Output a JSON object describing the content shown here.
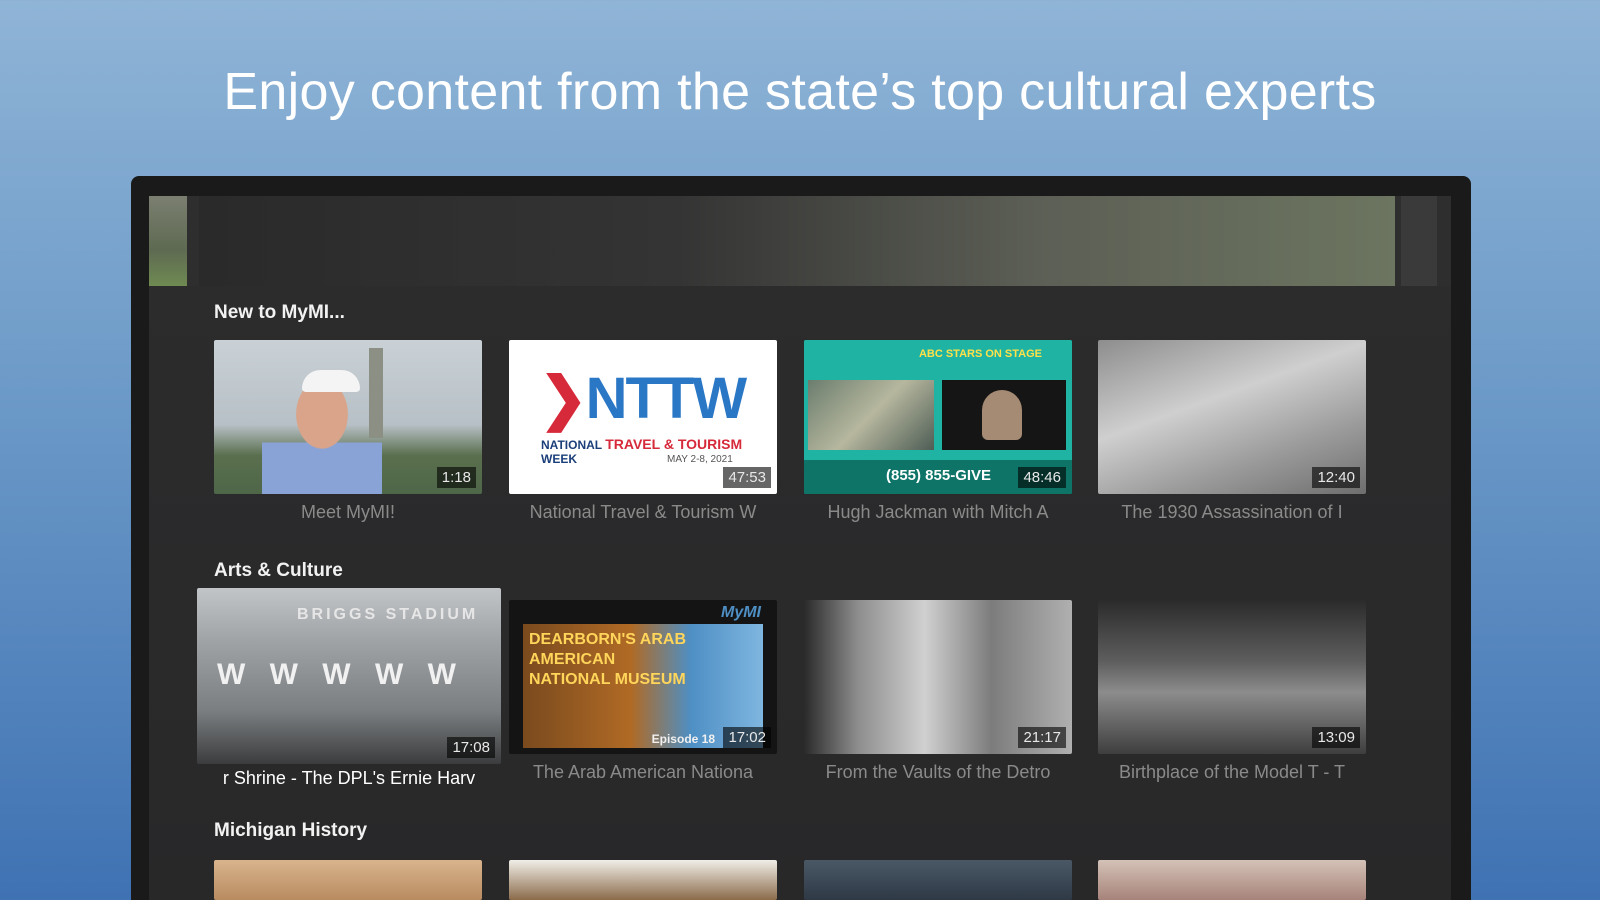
{
  "headline": "Enjoy content from the state’s top cultural experts",
  "rows": [
    {
      "title": "New to MyMI...",
      "items": [
        {
          "caption": "Meet MyMI!",
          "duration": "1:18"
        },
        {
          "caption": "National Travel & Tourism W",
          "duration": "47:53"
        },
        {
          "caption": "Hugh Jackman with Mitch A",
          "duration": "48:46"
        },
        {
          "caption": "The 1930 Assassination of I",
          "duration": "12:40"
        }
      ]
    },
    {
      "title": "Arts & Culture",
      "items": [
        {
          "caption": "r Shrine - The DPL's Ernie Harv",
          "duration": "17:08"
        },
        {
          "caption": "The Arab American Nationa",
          "duration": "17:02"
        },
        {
          "caption": "From the Vaults of the Detro",
          "duration": "21:17"
        },
        {
          "caption": "Birthplace of the Model T - T",
          "duration": "13:09"
        }
      ]
    },
    {
      "title": "Michigan History",
      "items": []
    }
  ],
  "thumbs": {
    "nttw_logo": "NTTW",
    "nttw_sub_national": "NATIONAL",
    "nttw_sub_travel": "TRAVEL & TOURISM",
    "nttw_sub_week": "WEEK",
    "nttw_date": "MAY 2-8, 2021",
    "hugh_banner": "ABC STARS ON STAGE",
    "hugh_phone": "(855) 855-GIVE",
    "briggs_sign": "BRIGGS STADIUM",
    "arab_title": "DEARBORN'S ARAB AMERICAN NATIONAL MUSEUM",
    "arab_brand": "MyMI",
    "arab_episode": "Episode 18"
  }
}
